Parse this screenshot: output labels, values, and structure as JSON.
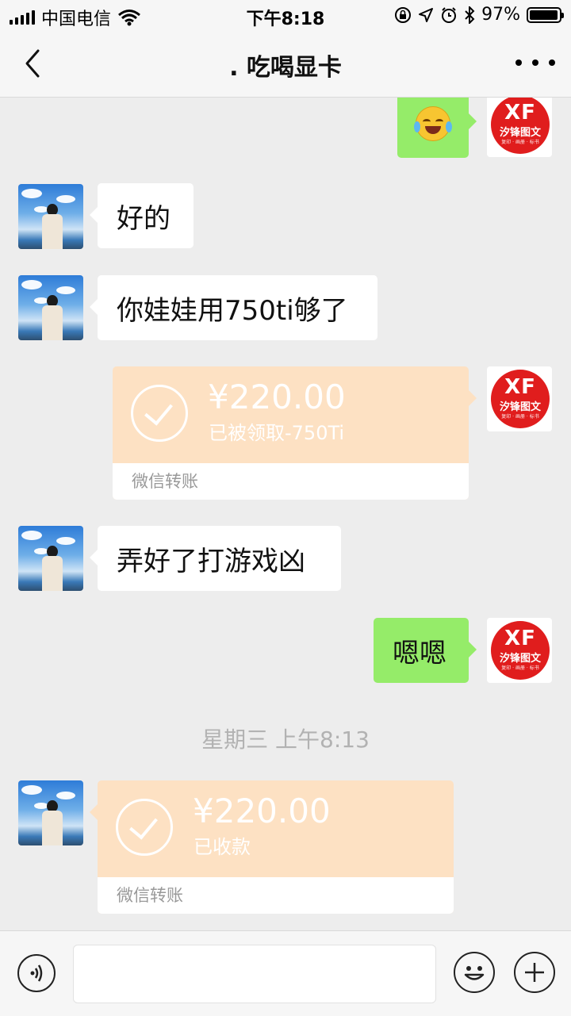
{
  "status_bar": {
    "carrier": "中国电信",
    "time": "下午8:18",
    "battery_percent": "97%",
    "battery_level": 0.97
  },
  "nav": {
    "title": ". 吃喝显卡"
  },
  "messages": [
    {
      "side": "right",
      "type": "emoji",
      "emoji_name": "crying-laughing-emoji"
    },
    {
      "side": "left",
      "type": "text",
      "text": "好的"
    },
    {
      "side": "left",
      "type": "text",
      "text": "你娃娃用750ti够了"
    },
    {
      "side": "right",
      "type": "transfer",
      "amount": "¥220.00",
      "status": "已被领取-750Ti",
      "footer": "微信转账"
    },
    {
      "side": "left",
      "type": "text",
      "text": "弄好了打游戏凶"
    },
    {
      "side": "right",
      "type": "text",
      "text": "嗯嗯"
    },
    {
      "type": "timestamp",
      "text": "星期三 上午8:13"
    },
    {
      "side": "left",
      "type": "transfer",
      "amount": "¥220.00",
      "status": "已收款",
      "footer": "微信转账"
    }
  ],
  "avatars": {
    "self_brand": {
      "line1": "XF",
      "line2": "汐锋图文",
      "line3": "复印 · 画册 · 标书"
    }
  },
  "input_bar": {
    "value": "",
    "placeholder": ""
  },
  "colors": {
    "chat_background": "#ededed",
    "own_bubble": "#95ec69",
    "transfer_card": "#fde1c3",
    "brand_red": "#e01d1d"
  }
}
